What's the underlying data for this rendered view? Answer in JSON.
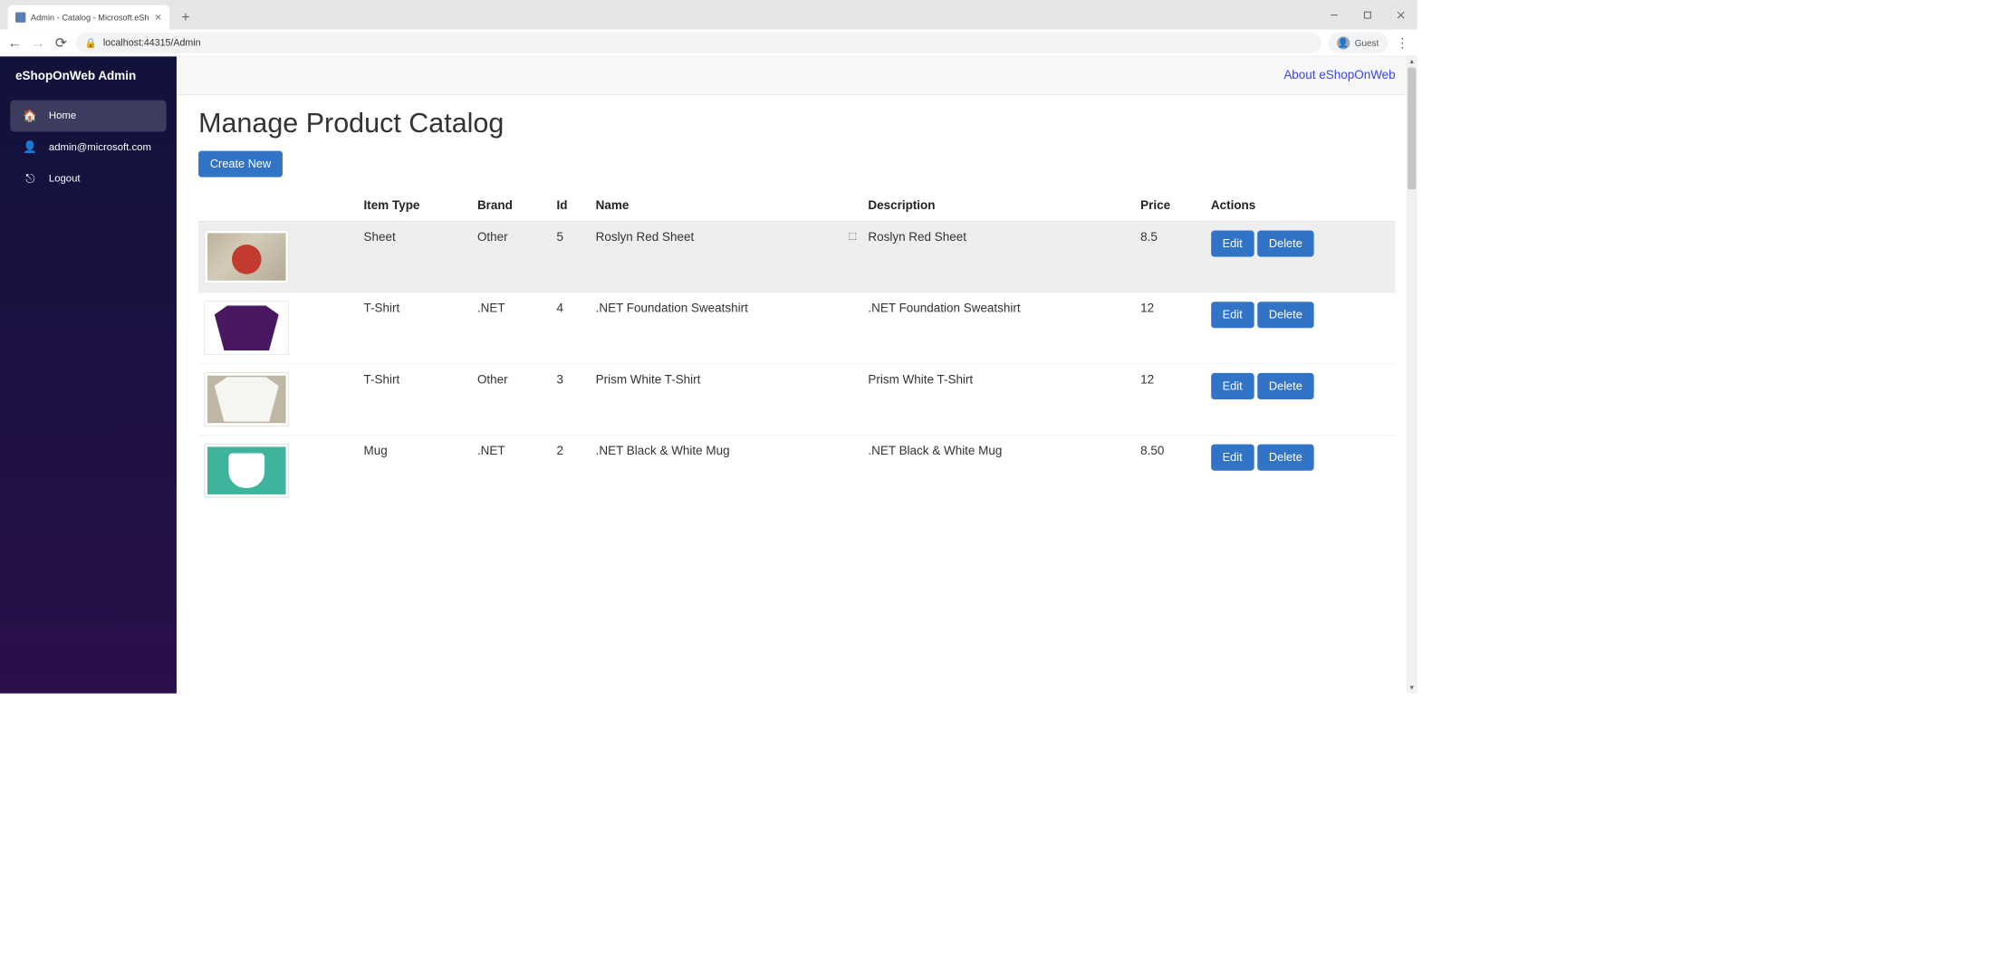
{
  "browser": {
    "tab_title": "Admin - Catalog - Microsoft.eSh",
    "url_host": "localhost:",
    "url_path": "44315/Admin",
    "profile_label": "Guest"
  },
  "sidebar": {
    "brand": "eShopOnWeb Admin",
    "items": [
      {
        "label": "Home",
        "active": true
      },
      {
        "label": "admin@microsoft.com",
        "active": false
      },
      {
        "label": "Logout",
        "active": false
      }
    ]
  },
  "topbar": {
    "about_link": "About eShopOnWeb"
  },
  "page": {
    "heading": "Manage Product Catalog",
    "create_button": "Create New"
  },
  "table": {
    "headers": [
      "",
      "Item Type",
      "Brand",
      "Id",
      "Name",
      "Description",
      "Price",
      "Actions"
    ],
    "edit_label": "Edit",
    "delete_label": "Delete",
    "rows": [
      {
        "item_type": "Sheet",
        "brand": "Other",
        "id": "5",
        "name": "Roslyn Red Sheet",
        "description": "Roslyn Red Sheet",
        "price": "8.5",
        "thumb": "wood",
        "hover": true
      },
      {
        "item_type": "T-Shirt",
        "brand": ".NET",
        "id": "4",
        "name": ".NET Foundation Sweatshirt",
        "description": ".NET Foundation Sweatshirt",
        "price": "12",
        "thumb": "purple",
        "hover": false
      },
      {
        "item_type": "T-Shirt",
        "brand": "Other",
        "id": "3",
        "name": "Prism White T-Shirt",
        "description": "Prism White T-Shirt",
        "price": "12",
        "thumb": "white",
        "hover": false
      },
      {
        "item_type": "Mug",
        "brand": ".NET",
        "id": "2",
        "name": ".NET Black & White Mug",
        "description": ".NET Black & White Mug",
        "price": "8.50",
        "thumb": "mug",
        "hover": false
      }
    ]
  }
}
